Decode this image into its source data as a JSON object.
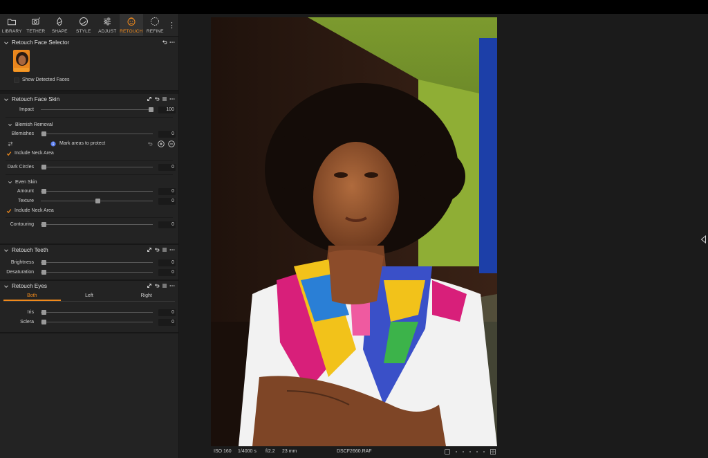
{
  "toolbar": {
    "tools": [
      {
        "label": "LIBRARY",
        "icon": "folder-icon"
      },
      {
        "label": "TETHER",
        "icon": "camera-icon"
      },
      {
        "label": "SHAPE",
        "icon": "shape-icon"
      },
      {
        "label": "STYLE",
        "icon": "style-icon"
      },
      {
        "label": "ADJUST",
        "icon": "sliders-icon"
      },
      {
        "label": "RETOUCH",
        "icon": "retouch-icon"
      },
      {
        "label": "REFINE",
        "icon": "refine-icon"
      }
    ],
    "active_tool": "RETOUCH",
    "more": "⋮"
  },
  "face_selector": {
    "title": "Retouch Face Selector",
    "show_faces_label": "Show Detected Faces"
  },
  "face_skin": {
    "title": "Retouch Face Skin",
    "impact": {
      "label": "Impact",
      "value": "100",
      "level": 1.0
    },
    "blemish": {
      "title": "Blemish Removal",
      "blemishes": {
        "label": "Blemishes",
        "value": "0",
        "level": 0
      },
      "protect_label": "Mark areas to protect",
      "neck_label": "Include Neck Area"
    },
    "dark_circles": {
      "label": "Dark Circles",
      "value": "0",
      "level": 0
    },
    "even_skin": {
      "title": "Even Skin",
      "amount": {
        "label": "Amount",
        "value": "0",
        "level": 0
      },
      "texture": {
        "label": "Texture",
        "value": "0",
        "level": 0.5
      },
      "neck_label": "Include Neck Area"
    },
    "contouring": {
      "label": "Contouring",
      "value": "0",
      "level": 0
    }
  },
  "teeth": {
    "title": "Retouch Teeth",
    "brightness": {
      "label": "Brightness",
      "value": "0",
      "level": 0
    },
    "desaturation": {
      "label": "Desaturation",
      "value": "0",
      "level": 0
    }
  },
  "eyes": {
    "title": "Retouch Eyes",
    "tabs": [
      "Both",
      "Left",
      "Right"
    ],
    "active_tab": "Both",
    "iris": {
      "label": "Iris",
      "value": "0",
      "level": 0
    },
    "sclera": {
      "label": "Sclera",
      "value": "0",
      "level": 0
    }
  },
  "image_info": {
    "iso": "ISO 160",
    "shutter": "1/4000 s",
    "aperture": "f/2.2",
    "focal": "23 mm",
    "filename": "DSCF2660.RAF"
  },
  "colors": {
    "accent": "#f08a1c",
    "panel_bg": "#232323",
    "viewer_bg": "#1b1b1b"
  }
}
